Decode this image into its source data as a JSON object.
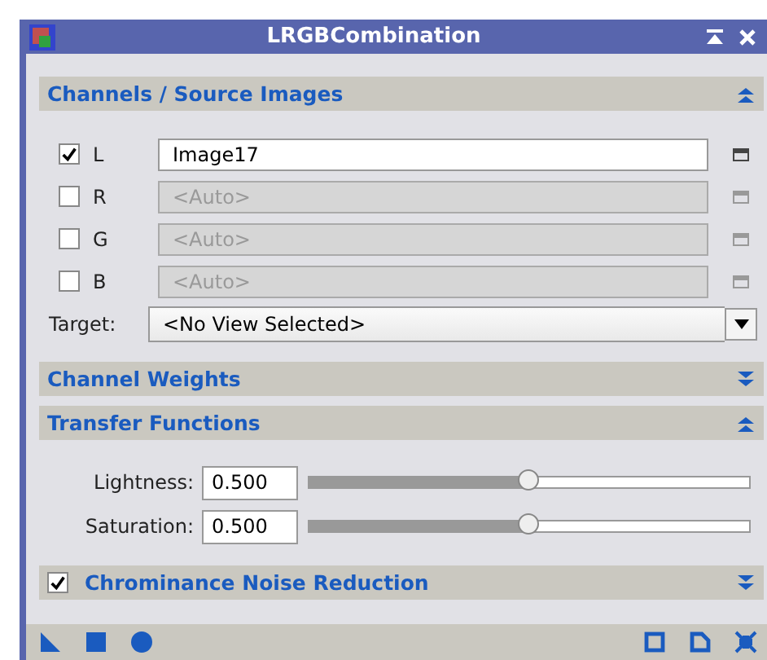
{
  "window": {
    "title": "LRGBCombination"
  },
  "sections": [
    {
      "kind": "channels",
      "title": "Channels / Source Images",
      "expanded": true,
      "channels": [
        {
          "label": "L",
          "checked": true,
          "value": "Image17",
          "enabled": true
        },
        {
          "label": "R",
          "checked": false,
          "placeholder": "<Auto>",
          "enabled": false
        },
        {
          "label": "G",
          "checked": false,
          "placeholder": "<Auto>",
          "enabled": false
        },
        {
          "label": "B",
          "checked": false,
          "placeholder": "<Auto>",
          "enabled": false
        }
      ],
      "target": {
        "label": "Target:",
        "value": "<No View Selected>"
      }
    },
    {
      "title": "Channel Weights",
      "expanded": false
    },
    {
      "kind": "transfer",
      "title": "Transfer Functions",
      "expanded": true,
      "params": [
        {
          "label": "Lightness:",
          "value": "0.500",
          "level": 0.5
        },
        {
          "label": "Saturation:",
          "value": "0.500",
          "level": 0.5
        }
      ]
    },
    {
      "title": "Chrominance Noise Reduction",
      "expanded": false,
      "checked": true
    }
  ]
}
